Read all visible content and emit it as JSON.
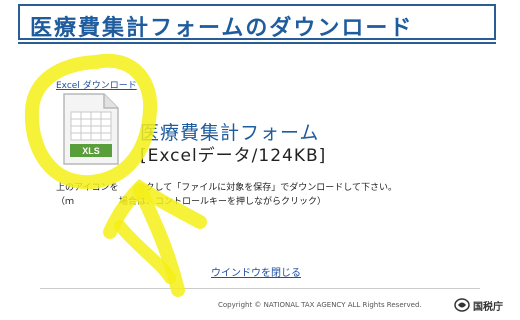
{
  "header": {
    "title": "医療費集計フォームのダウンロード"
  },
  "download": {
    "link_label": "Excel ダウンロード",
    "file_badge": "XLS",
    "product_title": "医療費集計フォーム",
    "product_meta": "[Excelデータ/124KB]"
  },
  "instructions": {
    "line1": "上のアイコンを　　ックして「ファイルに対象を保存」でダウンロードして下さい。",
    "line2": "（ｍ　　　　　場合は、コントロールキーを押しながらクリック）"
  },
  "footer": {
    "close_label": "ウインドウを閉じる",
    "copyright": "Copyright © NATIONAL TAX AGENCY ALL Rights Reserved.",
    "agency_name": "国税庁"
  },
  "colors": {
    "header_blue": "#1f5c9e",
    "link_blue": "#1f4fa0",
    "annotation_yellow": "#f5ee16",
    "xls_green": "#5a9e3c"
  },
  "icons": {
    "file": "excel-file-icon",
    "agency": "agency-emblem-icon"
  }
}
